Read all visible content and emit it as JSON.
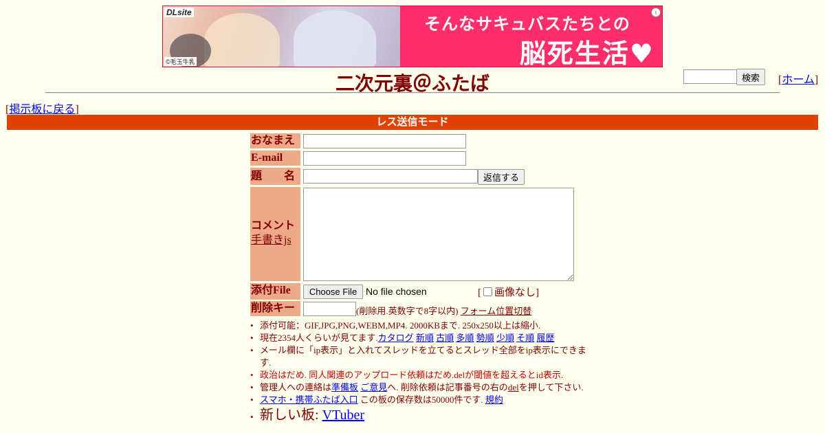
{
  "banner": {
    "logo": "DLsite",
    "tagline": "そんなサキュバスたちとの",
    "headline": "脳死生活♥",
    "credit": "©毛玉牛乳",
    "info_glyph": "i"
  },
  "header": {
    "title": "二次元裏＠ふたば",
    "search_button": "検索",
    "home_link": "ホーム",
    "back_link": "掲示板に戻る"
  },
  "mode_bar": "レス送信モード",
  "form": {
    "name_label": "おなまえ",
    "email_label": "E-mail",
    "subject_label": "題　　名",
    "submit_button": "返信する",
    "comment_label": "コメント",
    "handwriting_link": "手書きjs",
    "file_label": "添付File",
    "choose_file_button": "Choose File",
    "file_status": "No file chosen",
    "no_image_label": "画像なし",
    "delkey_label": "削除キー",
    "delkey_note": "(削除用.英数字で8字以内)",
    "form_toggle_link": "フォーム位置切替"
  },
  "notes": {
    "attach": "添付可能：GIF,JPG,PNG,WEBM,MP4. 2000KBまで. 250x250以上は縮小.",
    "viewers_prefix": "現在2354人くらいが見てます.",
    "sort_links": [
      "カタログ",
      "新順",
      "古順",
      "多順",
      "勢順",
      "少順",
      "そ順",
      "履歴"
    ],
    "ip_notice": "メール欄に「ip表示」と入れてスレッドを立てるとスレッド全部をip表示にできます.",
    "politics": "政治はだめ. 同人関連のアップロード依頼はだめ.delが閾値を超えるとid表示.",
    "admin_prefix": "管理人への連絡は",
    "admin_link1": "準備板",
    "admin_link2": "ご意見",
    "admin_mid": "へ. 削除依頼は記事番号の右の",
    "admin_del": "del",
    "admin_suffix": "を押して下さい.",
    "mobile_link": "スマホ・携帯ふたば入口",
    "retention": "この板の保存数は50000件です.",
    "rules_link": "規約",
    "new_board_prefix": "新しい板:",
    "new_board_link": "VTuber"
  }
}
